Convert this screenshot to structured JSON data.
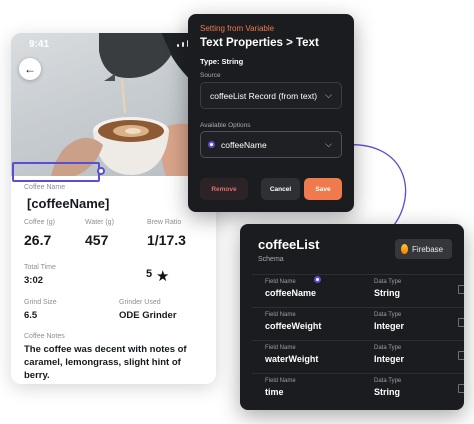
{
  "phone": {
    "status_time": "9:41",
    "field_name_label": "Coffee Name",
    "field_name_value": "[coffeeName]",
    "stats": [
      {
        "label": "Coffee (g)",
        "value": "26.7"
      },
      {
        "label": "Water (g)",
        "value": "457"
      },
      {
        "label": "Brew Ratio",
        "value": "1/17.3"
      }
    ],
    "total_time_label": "Total Time",
    "total_time_value": "3:02",
    "rating_value": "5",
    "grind_size_label": "Grind Size",
    "grind_size_value": "6.5",
    "grinder_label": "Grinder Used",
    "grinder_value": "ODE Grinder",
    "notes_label": "Coffee Notes",
    "notes_value": "The coffee was decent with notes of caramel, lemongrass, slight hint of berry."
  },
  "popup": {
    "kicker": "Setting from Variable",
    "title": "Text Properties > Text",
    "type": "Type: String",
    "source_label": "Source",
    "source_value": "coffeeList Record (from text)",
    "options_label": "Available Options",
    "options_value": "coffeeName",
    "remove_label": "Remove",
    "cancel_label": "Cancel",
    "save_label": "Save"
  },
  "schema": {
    "name": "coffeeList",
    "subtitle": "Schema",
    "badge": "Firebase",
    "field_label": "Field Name",
    "type_label": "Data Type",
    "rows": [
      {
        "field": "coffeeName",
        "type": "String"
      },
      {
        "field": "coffeeWeight",
        "type": "Integer"
      },
      {
        "field": "waterWeight",
        "type": "Integer"
      },
      {
        "field": "time",
        "type": "String"
      }
    ]
  },
  "colors": {
    "accent": "#5b4ed6",
    "save": "#ef7a4d",
    "kicker": "#f07a4a",
    "panel": "#1b1c1f"
  }
}
